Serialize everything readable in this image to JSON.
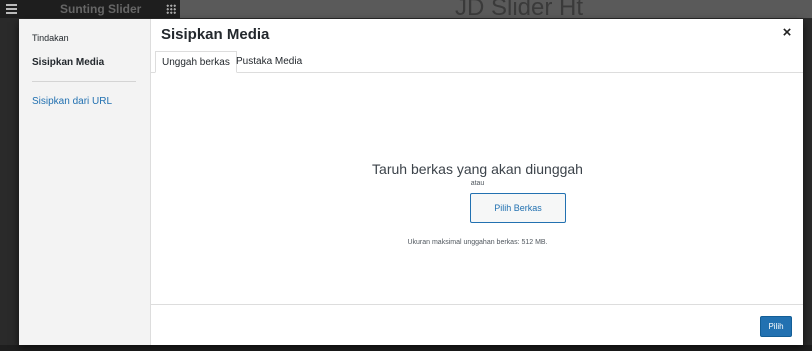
{
  "background": {
    "brand": "Sunting Slider",
    "title_fragment": "JD Slider Ht"
  },
  "modal": {
    "sidebar": {
      "heading": "Tindakan",
      "items": [
        {
          "label": "Sisipkan Media",
          "active": true
        },
        {
          "label": "Sisipkan dari URL",
          "active": false
        }
      ]
    },
    "title": "Sisipkan Media",
    "close_icon": "×",
    "tabs": [
      {
        "label": "Unggah berkas",
        "active": true
      },
      {
        "label": "Pustaka Media",
        "active": false
      }
    ],
    "uploader": {
      "drop_title": "Taruh berkas yang akan diunggah",
      "or_text": "atau",
      "select_button": "Pilih Berkas",
      "max_size": "Ukuran maksimal unggahan berkas: 512 MB."
    },
    "toolbar": {
      "primary_button": "Pilih"
    }
  },
  "colors": {
    "accent": "#2271b1",
    "text": "#23282d"
  }
}
